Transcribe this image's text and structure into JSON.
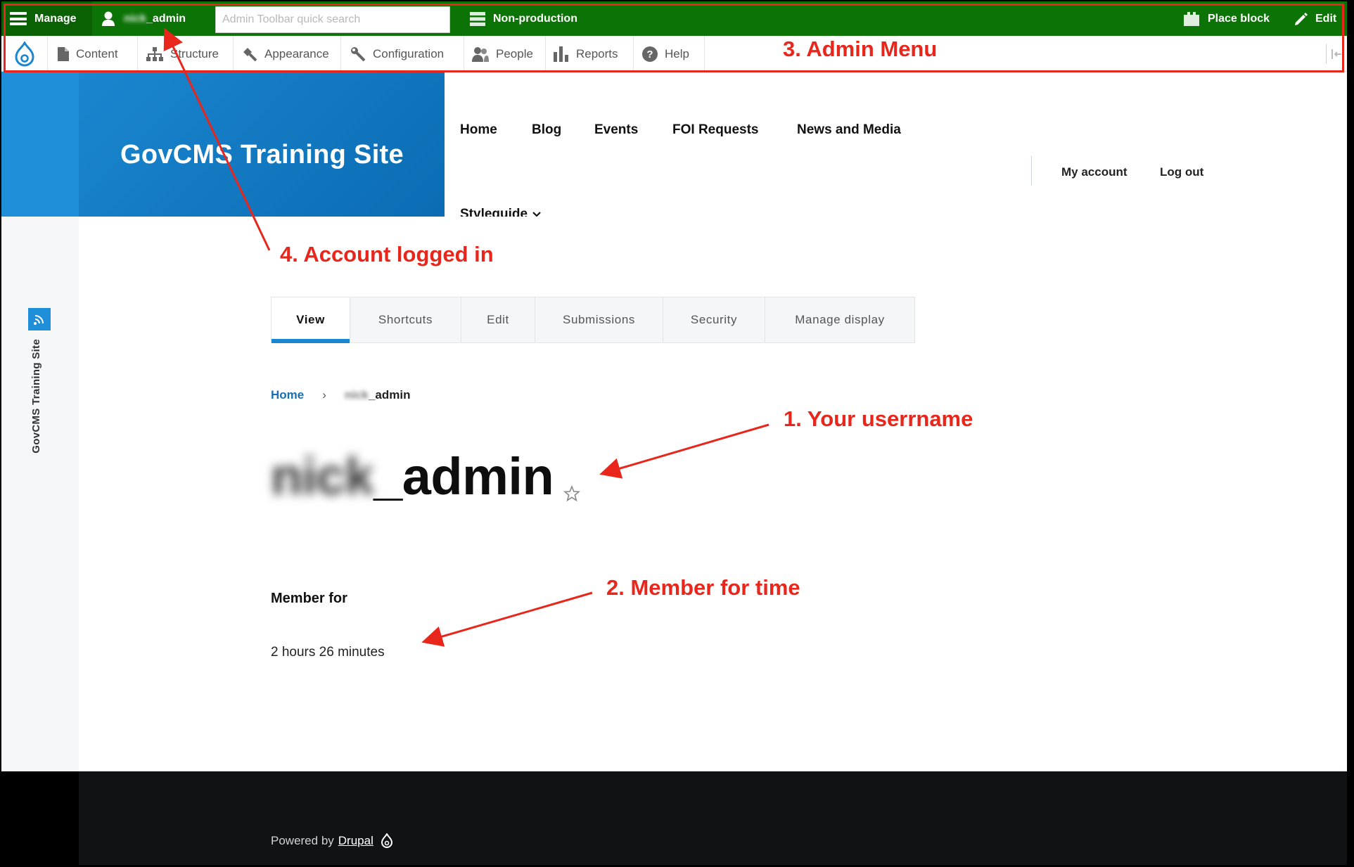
{
  "toolbar": {
    "manage_label": "Manage",
    "user_prefix": "nick",
    "user_suffix": "_admin",
    "search_placeholder": "Admin Toolbar quick search",
    "environment_label": "Non-production",
    "place_block_label": "Place block",
    "edit_label": "Edit"
  },
  "tray": {
    "items": [
      {
        "label": "Content",
        "icon": "document-icon"
      },
      {
        "label": "Structure",
        "icon": "hierarchy-icon"
      },
      {
        "label": "Appearance",
        "icon": "paint-icon"
      },
      {
        "label": "Configuration",
        "icon": "wrench-icon"
      },
      {
        "label": "People",
        "icon": "people-icon"
      },
      {
        "label": "Reports",
        "icon": "bar-chart-icon"
      },
      {
        "label": "Help",
        "icon": "help-icon"
      }
    ]
  },
  "site": {
    "name": "GovCMS Training Site",
    "sidebar_name": "GovCMS Training Site"
  },
  "main_nav": {
    "items": [
      "Home",
      "Blog",
      "Events",
      "FOI Requests",
      "News and Media"
    ],
    "styleguide_label": "Styleguide"
  },
  "account_nav": {
    "my_account": "My account",
    "log_out": "Log out"
  },
  "tabs": [
    {
      "label": "View",
      "active": true
    },
    {
      "label": "Shortcuts",
      "active": false
    },
    {
      "label": "Edit",
      "active": false
    },
    {
      "label": "Submissions",
      "active": false
    },
    {
      "label": "Security",
      "active": false
    },
    {
      "label": "Manage display",
      "active": false
    }
  ],
  "breadcrumb": {
    "home": "Home",
    "separator": "›",
    "current_prefix": "nick",
    "current_suffix": "_admin"
  },
  "page": {
    "title_prefix": "nick",
    "title_suffix": "_admin",
    "member_for_label": "Member for",
    "member_for_value": "2 hours 26 minutes"
  },
  "footer": {
    "powered_by": "Powered by",
    "drupal_link": "Drupal"
  },
  "annotations": {
    "admin_menu": "3. Admin Menu",
    "account_logged_in": "4. Account logged in",
    "your_username": "1. Your userrname",
    "member_for_time": "2. Member for time",
    "color": "#e8261c"
  },
  "colors": {
    "toolbar_green": "#0c7306",
    "brand_blue": "#1a86cf",
    "footer_dark": "#101214"
  }
}
